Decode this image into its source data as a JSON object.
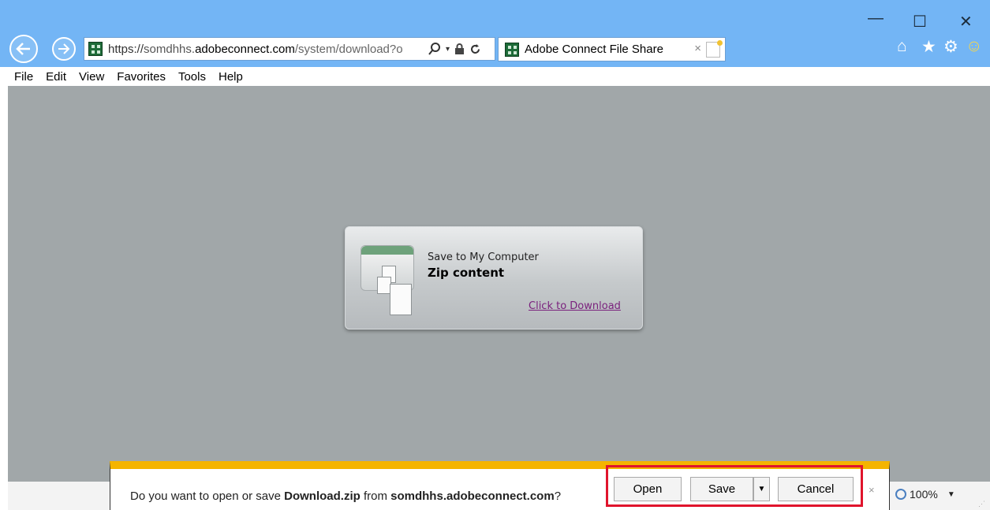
{
  "browser": {
    "address": {
      "url_proto": "https://",
      "url_sub": "somdhhs.",
      "url_domain": "adobeconnect.com",
      "url_path": "/system/download?o"
    },
    "tab": {
      "title": "Adobe Connect File Share",
      "close_glyph": "×"
    },
    "window_controls": {
      "minimize": "—",
      "maximize": "☐",
      "close": "✕"
    }
  },
  "menubar": {
    "items": [
      "File",
      "Edit",
      "View",
      "Favorites",
      "Tools",
      "Help"
    ]
  },
  "download_card": {
    "line1": "Save to My Computer",
    "line2": "Zip content",
    "link": "Click to Download"
  },
  "notification": {
    "prefix": "Do you want to open or save ",
    "filename": "Download.zip",
    "middle": " from ",
    "source": "somdhhs.adobeconnect.com",
    "suffix": "?",
    "open_label": "Open",
    "save_label": "Save",
    "cancel_label": "Cancel",
    "close_glyph": "×"
  },
  "statusbar": {
    "zoom": "100%"
  },
  "colors": {
    "titlebar": "#73b5f5",
    "content_bg": "#a1a7a9",
    "notification_accent": "#f4b400",
    "highlight_box": "#e0142c",
    "link": "#7a217d"
  },
  "icons": [
    "back-icon",
    "forward-icon",
    "search-icon",
    "lock-icon",
    "refresh-icon",
    "home-icon",
    "favorites-star-icon",
    "gear-icon",
    "smiley-icon",
    "zoom-icon"
  ]
}
